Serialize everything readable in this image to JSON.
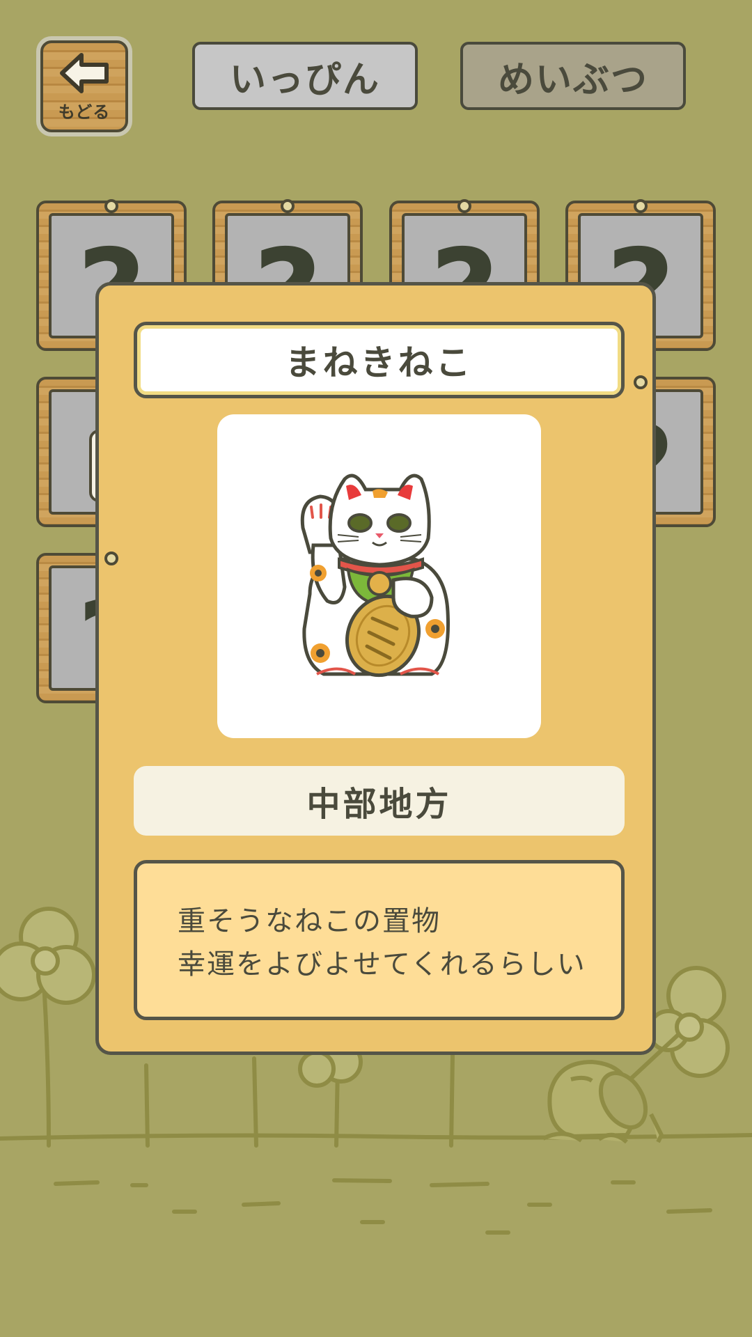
{
  "nav": {
    "back_label": "もどる",
    "back_icon": "left-arrow-icon"
  },
  "tabs": [
    {
      "label": "いっぴん",
      "selected": true
    },
    {
      "label": "めいぶつ",
      "selected": false
    }
  ],
  "grid": {
    "unknown_symbol": "?"
  },
  "modal": {
    "item_name": "まねきねこ",
    "item_icon": "maneki-neko-icon",
    "region": "中部地方",
    "description_lines": [
      "重そうなねこの置物",
      "幸運をよびよせてくれるらしい"
    ]
  },
  "colors": {
    "background": "#a8a564",
    "modal": "#ecc46d",
    "description_box": "#fedd97",
    "tab_selected": "#c6c6c6",
    "tab_unselected": "#a9a38a"
  }
}
